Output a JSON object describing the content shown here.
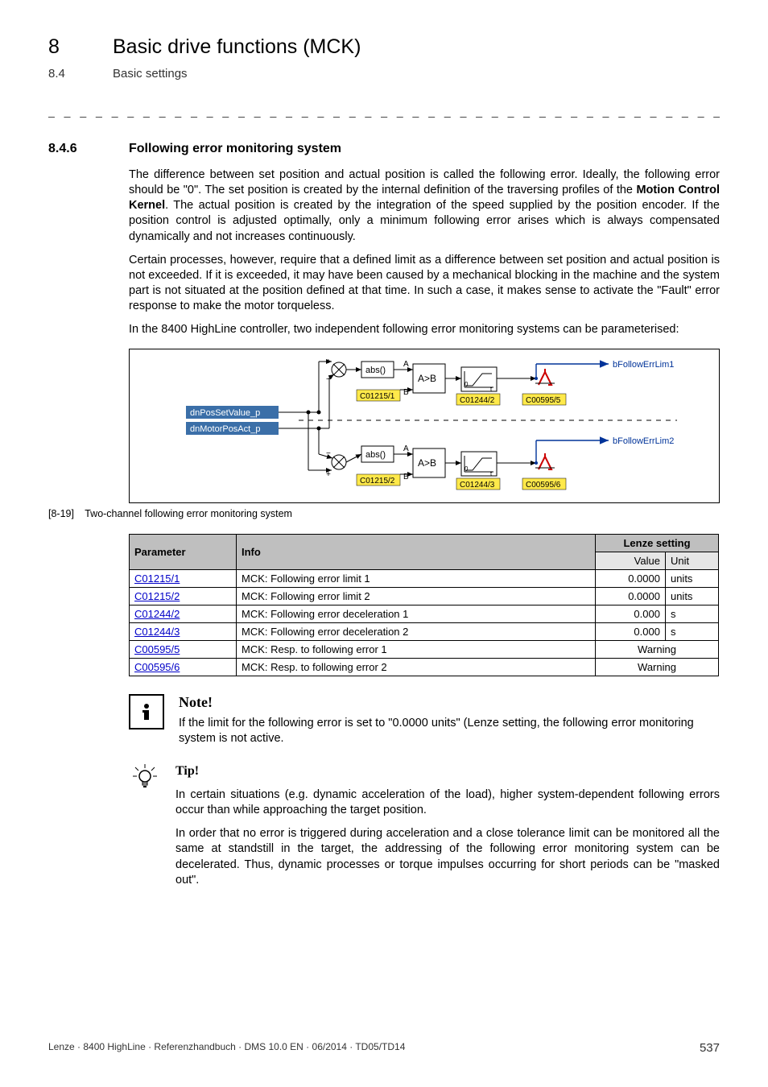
{
  "chapter": {
    "number": "8",
    "title": "Basic drive functions (MCK)"
  },
  "section": {
    "number": "8.4",
    "title": "Basic settings"
  },
  "dashes": "_ _ _ _ _ _ _ _ _ _ _ _ _ _ _ _ _ _ _ _ _ _ _ _ _ _ _ _ _ _ _ _ _ _ _ _ _ _ _ _ _ _ _ _ _ _ _ _ _ _ _ _ _ _ _ _ _ _ _ _ _ _ _ _",
  "h3": {
    "number": "8.4.6",
    "title": "Following error monitoring system"
  },
  "para1": "The difference between set position and actual position is called the following error. Ideally, the following error should be \"0\". The set position is created by the internal definition of the traversing profiles of the Motion Control Kernel. The actual position is created by the integration of the speed supplied by the position encoder. If the position control is adjusted optimally, only a minimum following error arises which is always compensated dynamically and not increases continuously.",
  "para1_bold": "Motion Control Kernel",
  "para2": "Certain processes, however, require that a defined limit as a difference between set position and actual position is not exceeded. If it is exceeded, it may have been caused by a mechanical blocking in the machine and the system part is not situated at the position defined at that time. In such a case, it makes sense to activate the \"Fault\" error response to make the motor torqueless.",
  "para3": "In the 8400 HighLine controller, two independent following error monitoring systems can be parameterised:",
  "diagram": {
    "sig1": "dnPosSetValue_p",
    "sig2": "dnMotorPosAct_p",
    "abs": "abs()",
    "cmp": "A>B",
    "A": "A",
    "B": "B",
    "p1": "C01215/1",
    "p2": "C01215/2",
    "d1": "C01244/2",
    "d2": "C01244/3",
    "r1": "C00595/5",
    "r2": "C00595/6",
    "out1": "bFollowErrLim1",
    "out2": "bFollowErrLim2",
    "zero": "0",
    "t": "t"
  },
  "caption": {
    "idx": "[8-19]",
    "text": "Two-channel following error monitoring system"
  },
  "table": {
    "headers": {
      "param": "Parameter",
      "info": "Info",
      "lenze": "Lenze setting",
      "value": "Value",
      "unit": "Unit"
    },
    "rows": [
      {
        "param": "C01215/1",
        "info": "MCK: Following error limit 1",
        "value": "0.0000",
        "unit": "units"
      },
      {
        "param": "C01215/2",
        "info": "MCK: Following error limit 2",
        "value": "0.0000",
        "unit": "units"
      },
      {
        "param": "C01244/2",
        "info": "MCK: Following error deceleration 1",
        "value": "0.000",
        "unit": "s"
      },
      {
        "param": "C01244/3",
        "info": "MCK: Following error deceleration 2",
        "value": "0.000",
        "unit": "s"
      },
      {
        "param": "C00595/5",
        "info": "MCK: Resp. to following error 1",
        "value": "Warning",
        "unit": ""
      },
      {
        "param": "C00595/6",
        "info": "MCK: Resp. to following error 2",
        "value": "Warning",
        "unit": ""
      }
    ]
  },
  "note": {
    "title": "Note!",
    "text": "If the limit for the following error is set to \"0.0000 units\" (Lenze setting, the following error monitoring system is not active."
  },
  "tip": {
    "title": "Tip!",
    "p1": "In certain situations (e.g. dynamic acceleration of the load), higher system-dependent following errors occur than while approaching the target position.",
    "p2": "In order that no error is triggered during acceleration and a close tolerance limit can be monitored all the same at standstill in the target, the addressing of the following error monitoring system can be decelerated. Thus, dynamic processes or torque impulses occurring for short periods can be \"masked out\"."
  },
  "footer": {
    "left": "Lenze · 8400 HighLine · Referenzhandbuch · DMS 10.0 EN · 06/2014 · TD05/TD14",
    "page": "537"
  }
}
